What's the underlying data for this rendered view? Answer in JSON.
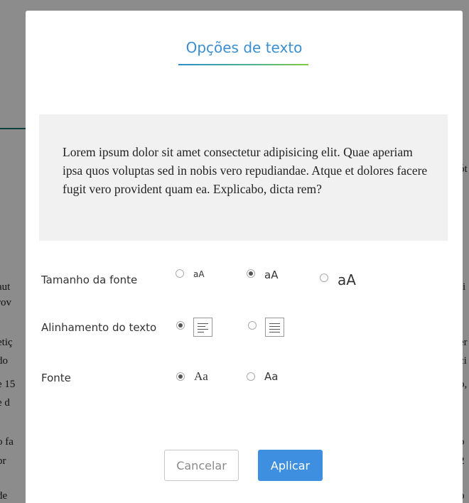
{
  "background": {
    "left_fragments": [
      "aut",
      "rov",
      "etiç",
      " do",
      "e 15",
      "e d",
      "o fa",
      " pr",
      " de"
    ],
    "right_fragments": [
      "ót",
      "ri",
      "er",
      "ci",
      "o,",
      "o",
      "2",
      "p"
    ]
  },
  "dialog": {
    "title": "Opções de texto",
    "preview_text": "Lorem ipsum dolor sit amet consectetur adipisicing elit. Quae aperiam ipsa quos voluptas sed in nobis vero repudiandae. Atque et dolores facere fugit vero provident quam ea. Explicabo, dicta rem?",
    "font_size": {
      "label": "Tamanho da fonte",
      "options": [
        "aA",
        "aA",
        "aA"
      ],
      "selected_index": 1
    },
    "alignment": {
      "label": "Alinhamento do texto",
      "options": [
        "align-left-icon",
        "align-justify-icon"
      ],
      "selected_index": 0
    },
    "font": {
      "label": "Fonte",
      "options": [
        "Aa",
        "Aa"
      ],
      "selected_index": 0
    },
    "cancel_label": "Cancelar",
    "apply_label": "Aplicar"
  },
  "colors": {
    "title": "#3b8fd1",
    "apply_button": "#3f8fe0",
    "preview_bg": "#f1f1f2"
  }
}
